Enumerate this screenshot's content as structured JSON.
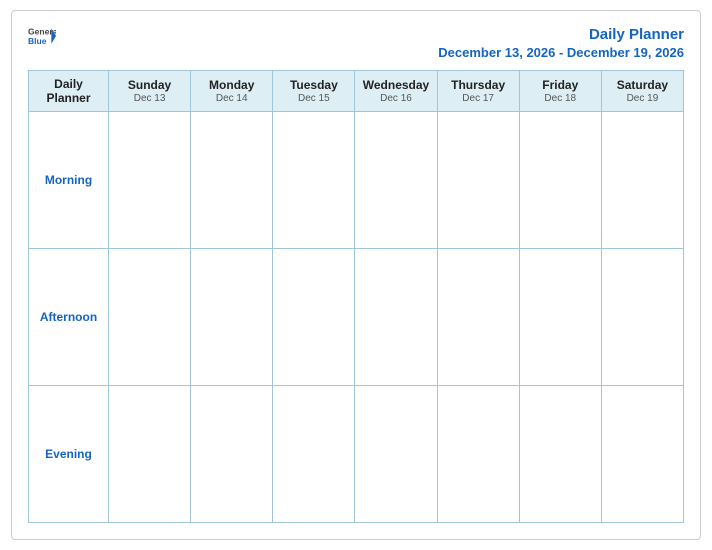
{
  "header": {
    "logo_general": "General",
    "logo_blue": "Blue",
    "planner_title": "Daily Planner",
    "date_range": "December 13, 2026 - December 19, 2026"
  },
  "columns": [
    {
      "id": "label",
      "day": "Daily",
      "day2": "Planner",
      "date": ""
    },
    {
      "id": "sun",
      "day": "Sunday",
      "date": "Dec 13"
    },
    {
      "id": "mon",
      "day": "Monday",
      "date": "Dec 14"
    },
    {
      "id": "tue",
      "day": "Tuesday",
      "date": "Dec 15"
    },
    {
      "id": "wed",
      "day": "Wednesday",
      "date": "Dec 16"
    },
    {
      "id": "thu",
      "day": "Thursday",
      "date": "Dec 17"
    },
    {
      "id": "fri",
      "day": "Friday",
      "date": "Dec 18"
    },
    {
      "id": "sat",
      "day": "Saturday",
      "date": "Dec 19"
    }
  ],
  "rows": [
    {
      "id": "morning",
      "label": "Morning"
    },
    {
      "id": "afternoon",
      "label": "Afternoon"
    },
    {
      "id": "evening",
      "label": "Evening"
    }
  ]
}
